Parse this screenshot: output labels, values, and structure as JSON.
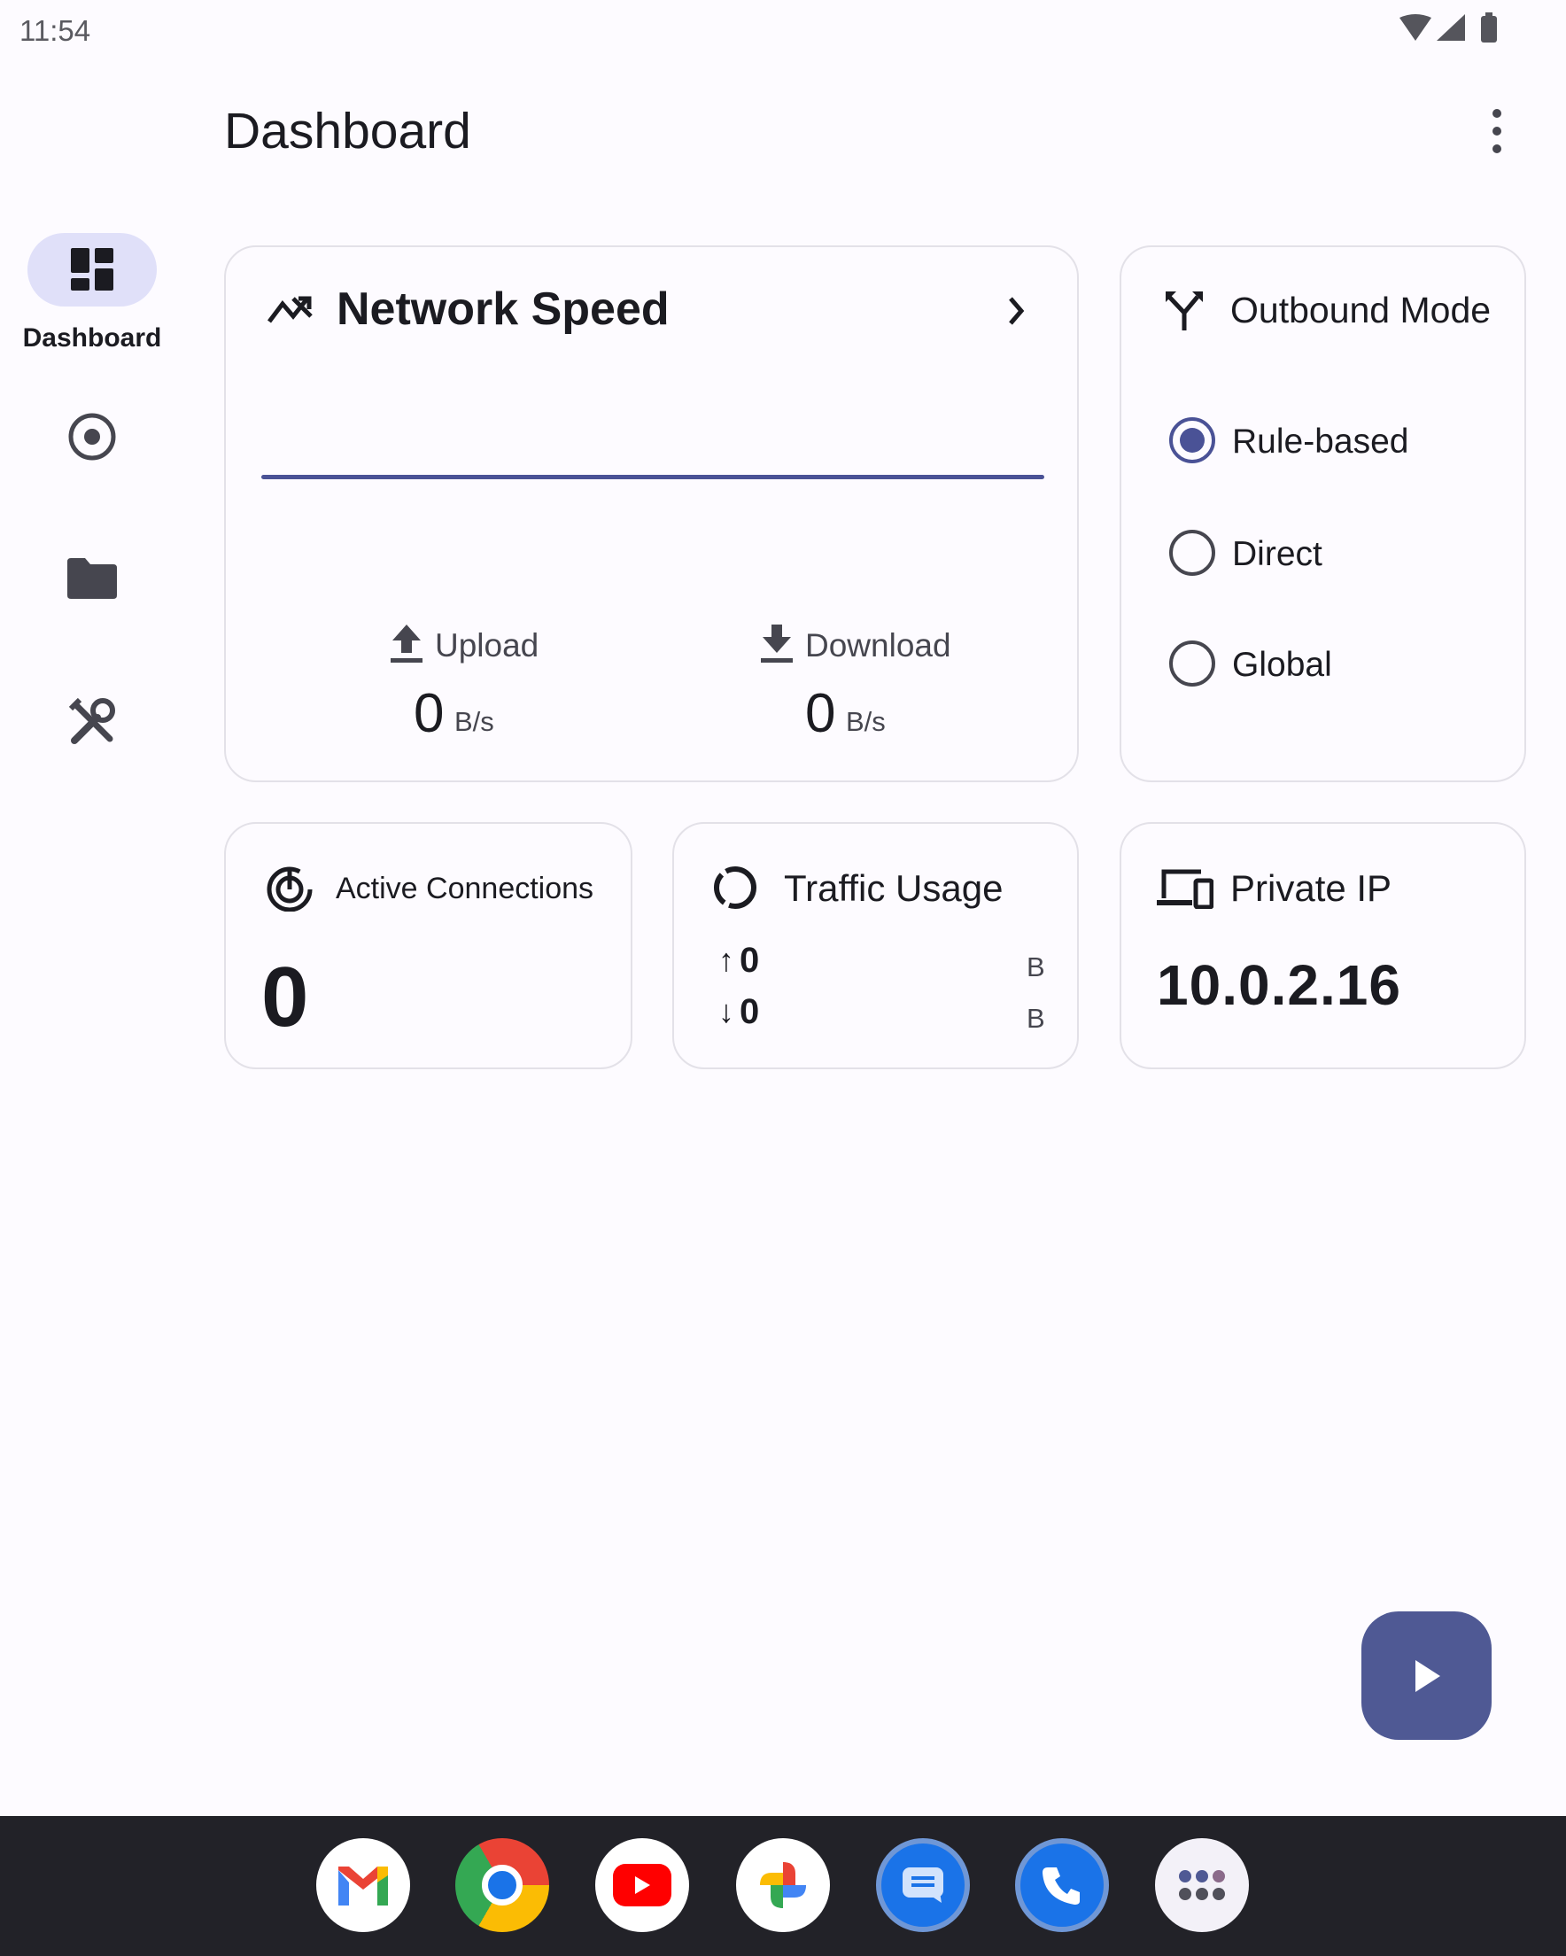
{
  "status_bar": {
    "time": "11:54",
    "icons": [
      "wifi-icon",
      "signal-icon",
      "battery-icon"
    ]
  },
  "app_bar": {
    "title": "Dashboard",
    "menu_icon": "more-vert-icon"
  },
  "nav_rail": {
    "items": [
      {
        "label": "Dashboard",
        "icon": "dashboard-icon",
        "selected": true
      },
      {
        "label": "",
        "icon": "proxy-target-icon"
      },
      {
        "label": "",
        "icon": "folder-icon"
      },
      {
        "label": "",
        "icon": "tools-icon"
      }
    ]
  },
  "network_speed": {
    "title": "Network Speed",
    "upload_label": "Upload",
    "upload_value": "0",
    "upload_unit": "B/s",
    "download_label": "Download",
    "download_value": "0",
    "download_unit": "B/s",
    "line_color": "#4a5296"
  },
  "outbound_mode": {
    "title": "Outbound Mode",
    "options": [
      {
        "label": "Rule-based",
        "selected": true
      },
      {
        "label": "Direct",
        "selected": false
      },
      {
        "label": "Global",
        "selected": false
      }
    ]
  },
  "active_connections": {
    "title": "Active Connections",
    "value": "0"
  },
  "traffic_usage": {
    "title": "Traffic Usage",
    "up_arrow": "↑",
    "up_value": "0",
    "up_unit": "B",
    "down_arrow": "↓",
    "down_value": "0",
    "down_unit": "B"
  },
  "private_ip": {
    "title": "Private IP",
    "value": "10.0.2.16"
  },
  "fab": {
    "icon": "play-icon",
    "color": "#4f5994"
  },
  "taskbar": {
    "apps": [
      "gmail-icon",
      "chrome-icon",
      "youtube-icon",
      "photos-icon",
      "messages-icon",
      "phone-icon",
      "app-drawer-icon"
    ]
  }
}
